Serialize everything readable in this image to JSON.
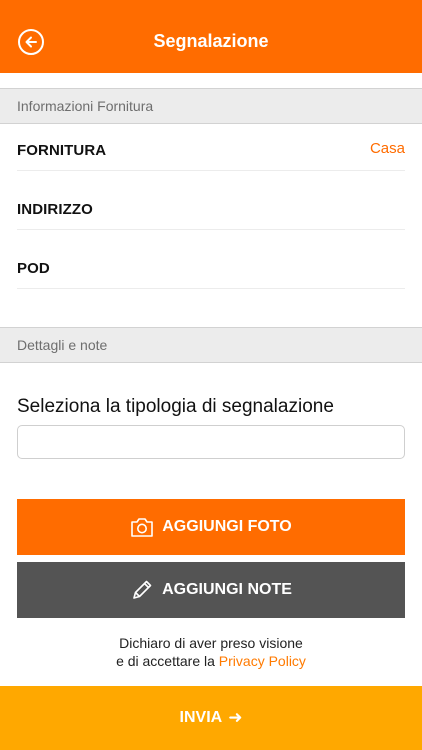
{
  "header": {
    "title": "Segnalazione",
    "back_icon": "back-arrow-circle-icon"
  },
  "sections": {
    "supply_info": "Informazioni Fornitura",
    "details": "Dettagli e note"
  },
  "supply_rows": [
    {
      "label": "FORNITURA",
      "value": "Casa"
    },
    {
      "label": "INDIRIZZO",
      "value": ""
    },
    {
      "label": "POD",
      "value": ""
    }
  ],
  "report_type": {
    "label": "Seleziona la tipologia di segnalazione",
    "value": "",
    "placeholder": ""
  },
  "buttons": {
    "add_photo": "AGGIUNGI FOTO",
    "add_notes": "AGGIUNGI NOTE"
  },
  "privacy": {
    "line1": "Dichiaro di aver preso visione",
    "line2_prefix": "e di accettare la ",
    "link": "Privacy Policy"
  },
  "submit": {
    "label": "INVIA",
    "arrow": "➜"
  },
  "colors": {
    "primary_orange": "#ff6c00",
    "submit_yellow": "#ffa800",
    "notes_gray": "#545454",
    "section_bg": "#ececec"
  }
}
